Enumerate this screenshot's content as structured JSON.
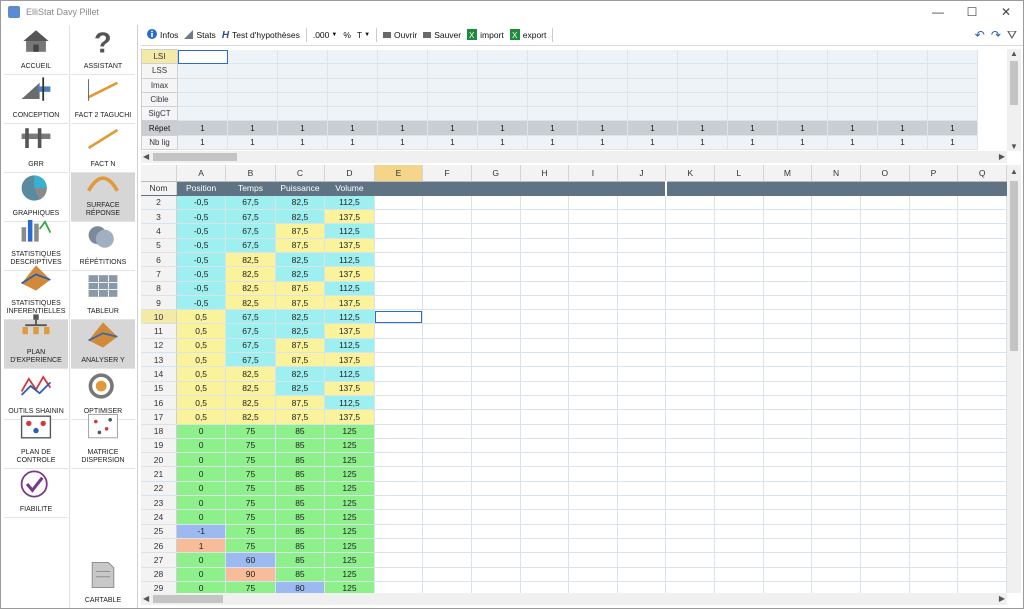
{
  "window": {
    "title": "ElliStat Davy Pillet",
    "minimize": "—",
    "maximize": "☐",
    "close": "✕"
  },
  "nav_left": [
    {
      "label": "ACCUEIL",
      "icon": "home-icon"
    },
    {
      "label": "CONCEPTION",
      "icon": "drafting-tools-icon"
    },
    {
      "label": "GRR",
      "icon": "caliper-icon"
    },
    {
      "label": "GRAPHIQUES",
      "icon": "pie-chart-icon"
    },
    {
      "label": "STATISTIQUES DESCRIPTIVES",
      "icon": "bar-chart-icon"
    },
    {
      "label": "STATISTIQUES INFERENTIELLES",
      "icon": "surface-3d-icon"
    },
    {
      "label": "PLAN D'EXPERIENCE",
      "icon": "experiment-tree-icon",
      "active": true
    },
    {
      "label": "OUTILS SHAININ",
      "icon": "shainin-curve-icon"
    },
    {
      "label": "PLAN DE CONTROLE",
      "icon": "control-plan-icon"
    },
    {
      "label": "FIABILITE",
      "icon": "checkmark-icon"
    }
  ],
  "nav_right": [
    {
      "label": "ASSISTANT",
      "icon": "question-icon"
    },
    {
      "label": "FACT 2 TAGUCHI",
      "icon": "taguchi-line-icon"
    },
    {
      "label": "FACT N",
      "icon": "fact-n-line-icon"
    },
    {
      "label": "SURFACE RÉPONSE",
      "icon": "response-surface-icon",
      "active": true
    },
    {
      "label": "RÉPÉTITIONS",
      "icon": "repetition-icon"
    },
    {
      "label": "TABLEUR",
      "icon": "spreadsheet-icon"
    },
    {
      "label": "ANALYSER Y",
      "icon": "analyze-icon",
      "active": true
    },
    {
      "label": "OPTIMISER",
      "icon": "target-icon"
    },
    {
      "label": "MATRICE DISPERSION",
      "icon": "scatter-matrix-icon"
    },
    {
      "label": "CARTABLE",
      "icon": "document-icon"
    }
  ],
  "toolbar": {
    "infos": "Infos",
    "stats": "Stats",
    "test": "Test d'hypothèses",
    "format": ".000",
    "percent": "%",
    "text": "T",
    "open": "Ouvrir",
    "save": "Sauver",
    "import": "import",
    "export": "export",
    "undo": "↶",
    "redo": "↷",
    "filter": "⛛"
  },
  "spec_rows": [
    {
      "label": "LSI",
      "selected": true
    },
    {
      "label": "LSS"
    },
    {
      "label": "Imax"
    },
    {
      "label": "Cible"
    },
    {
      "label": "SigCT"
    },
    {
      "label": "Répet",
      "repeat": true,
      "value": "1"
    },
    {
      "label": "Nb lig",
      "value": "1"
    }
  ],
  "spec_cols": 16,
  "columns": [
    "A",
    "B",
    "C",
    "D",
    "E",
    "F",
    "G",
    "H",
    "I",
    "J",
    "K",
    "L",
    "M",
    "N",
    "O",
    "P",
    "Q"
  ],
  "selected_column": "E",
  "header_row": {
    "label": "Nom",
    "names": [
      "Position",
      "Temps",
      "Puissance",
      "Volume"
    ]
  },
  "selected_row": "10",
  "rows": [
    {
      "n": "2",
      "v": [
        "-0,5",
        "67,5",
        "82,5",
        "112,5"
      ],
      "c": [
        "cyan",
        "cyan",
        "cyan",
        "cyan"
      ]
    },
    {
      "n": "3",
      "v": [
        "-0,5",
        "67,5",
        "82,5",
        "137,5"
      ],
      "c": [
        "cyan",
        "cyan",
        "cyan",
        "yellow"
      ]
    },
    {
      "n": "4",
      "v": [
        "-0,5",
        "67,5",
        "87,5",
        "112,5"
      ],
      "c": [
        "cyan",
        "cyan",
        "yellow",
        "cyan"
      ]
    },
    {
      "n": "5",
      "v": [
        "-0,5",
        "67,5",
        "87,5",
        "137,5"
      ],
      "c": [
        "cyan",
        "cyan",
        "yellow",
        "yellow"
      ]
    },
    {
      "n": "6",
      "v": [
        "-0,5",
        "82,5",
        "82,5",
        "112,5"
      ],
      "c": [
        "cyan",
        "yellow",
        "cyan",
        "cyan"
      ]
    },
    {
      "n": "7",
      "v": [
        "-0,5",
        "82,5",
        "82,5",
        "137,5"
      ],
      "c": [
        "cyan",
        "yellow",
        "cyan",
        "yellow"
      ]
    },
    {
      "n": "8",
      "v": [
        "-0,5",
        "82,5",
        "87,5",
        "112,5"
      ],
      "c": [
        "cyan",
        "yellow",
        "yellow",
        "cyan"
      ]
    },
    {
      "n": "9",
      "v": [
        "-0,5",
        "82,5",
        "87,5",
        "137,5"
      ],
      "c": [
        "cyan",
        "yellow",
        "yellow",
        "yellow"
      ]
    },
    {
      "n": "10",
      "v": [
        "0,5",
        "67,5",
        "82,5",
        "112,5"
      ],
      "c": [
        "yellow",
        "cyan",
        "cyan",
        "cyan"
      ]
    },
    {
      "n": "11",
      "v": [
        "0,5",
        "67,5",
        "82,5",
        "137,5"
      ],
      "c": [
        "yellow",
        "cyan",
        "cyan",
        "yellow"
      ]
    },
    {
      "n": "12",
      "v": [
        "0,5",
        "67,5",
        "87,5",
        "112,5"
      ],
      "c": [
        "yellow",
        "cyan",
        "yellow",
        "cyan"
      ]
    },
    {
      "n": "13",
      "v": [
        "0,5",
        "67,5",
        "87,5",
        "137,5"
      ],
      "c": [
        "yellow",
        "cyan",
        "yellow",
        "yellow"
      ]
    },
    {
      "n": "14",
      "v": [
        "0,5",
        "82,5",
        "82,5",
        "112,5"
      ],
      "c": [
        "yellow",
        "yellow",
        "cyan",
        "cyan"
      ]
    },
    {
      "n": "15",
      "v": [
        "0,5",
        "82,5",
        "82,5",
        "137,5"
      ],
      "c": [
        "yellow",
        "yellow",
        "cyan",
        "yellow"
      ]
    },
    {
      "n": "16",
      "v": [
        "0,5",
        "82,5",
        "87,5",
        "112,5"
      ],
      "c": [
        "yellow",
        "yellow",
        "yellow",
        "cyan"
      ]
    },
    {
      "n": "17",
      "v": [
        "0,5",
        "82,5",
        "87,5",
        "137,5"
      ],
      "c": [
        "yellow",
        "yellow",
        "yellow",
        "yellow"
      ]
    },
    {
      "n": "18",
      "v": [
        "0",
        "75",
        "85",
        "125"
      ],
      "c": [
        "green",
        "green",
        "green",
        "green"
      ]
    },
    {
      "n": "19",
      "v": [
        "0",
        "75",
        "85",
        "125"
      ],
      "c": [
        "green",
        "green",
        "green",
        "green"
      ]
    },
    {
      "n": "20",
      "v": [
        "0",
        "75",
        "85",
        "125"
      ],
      "c": [
        "green",
        "green",
        "green",
        "green"
      ]
    },
    {
      "n": "21",
      "v": [
        "0",
        "75",
        "85",
        "125"
      ],
      "c": [
        "green",
        "green",
        "green",
        "green"
      ]
    },
    {
      "n": "22",
      "v": [
        "0",
        "75",
        "85",
        "125"
      ],
      "c": [
        "green",
        "green",
        "green",
        "green"
      ]
    },
    {
      "n": "23",
      "v": [
        "0",
        "75",
        "85",
        "125"
      ],
      "c": [
        "green",
        "green",
        "green",
        "green"
      ]
    },
    {
      "n": "24",
      "v": [
        "0",
        "75",
        "85",
        "125"
      ],
      "c": [
        "green",
        "green",
        "green",
        "green"
      ]
    },
    {
      "n": "25",
      "v": [
        "-1",
        "75",
        "85",
        "125"
      ],
      "c": [
        "blue",
        "green",
        "green",
        "green"
      ]
    },
    {
      "n": "26",
      "v": [
        "1",
        "75",
        "85",
        "125"
      ],
      "c": [
        "orange",
        "green",
        "green",
        "green"
      ]
    },
    {
      "n": "27",
      "v": [
        "0",
        "60",
        "85",
        "125"
      ],
      "c": [
        "green",
        "blue",
        "green",
        "green"
      ]
    },
    {
      "n": "28",
      "v": [
        "0",
        "90",
        "85",
        "125"
      ],
      "c": [
        "green",
        "orange",
        "green",
        "green"
      ]
    },
    {
      "n": "29",
      "v": [
        "0",
        "75",
        "80",
        "125"
      ],
      "c": [
        "green",
        "green",
        "blue",
        "green"
      ]
    }
  ]
}
